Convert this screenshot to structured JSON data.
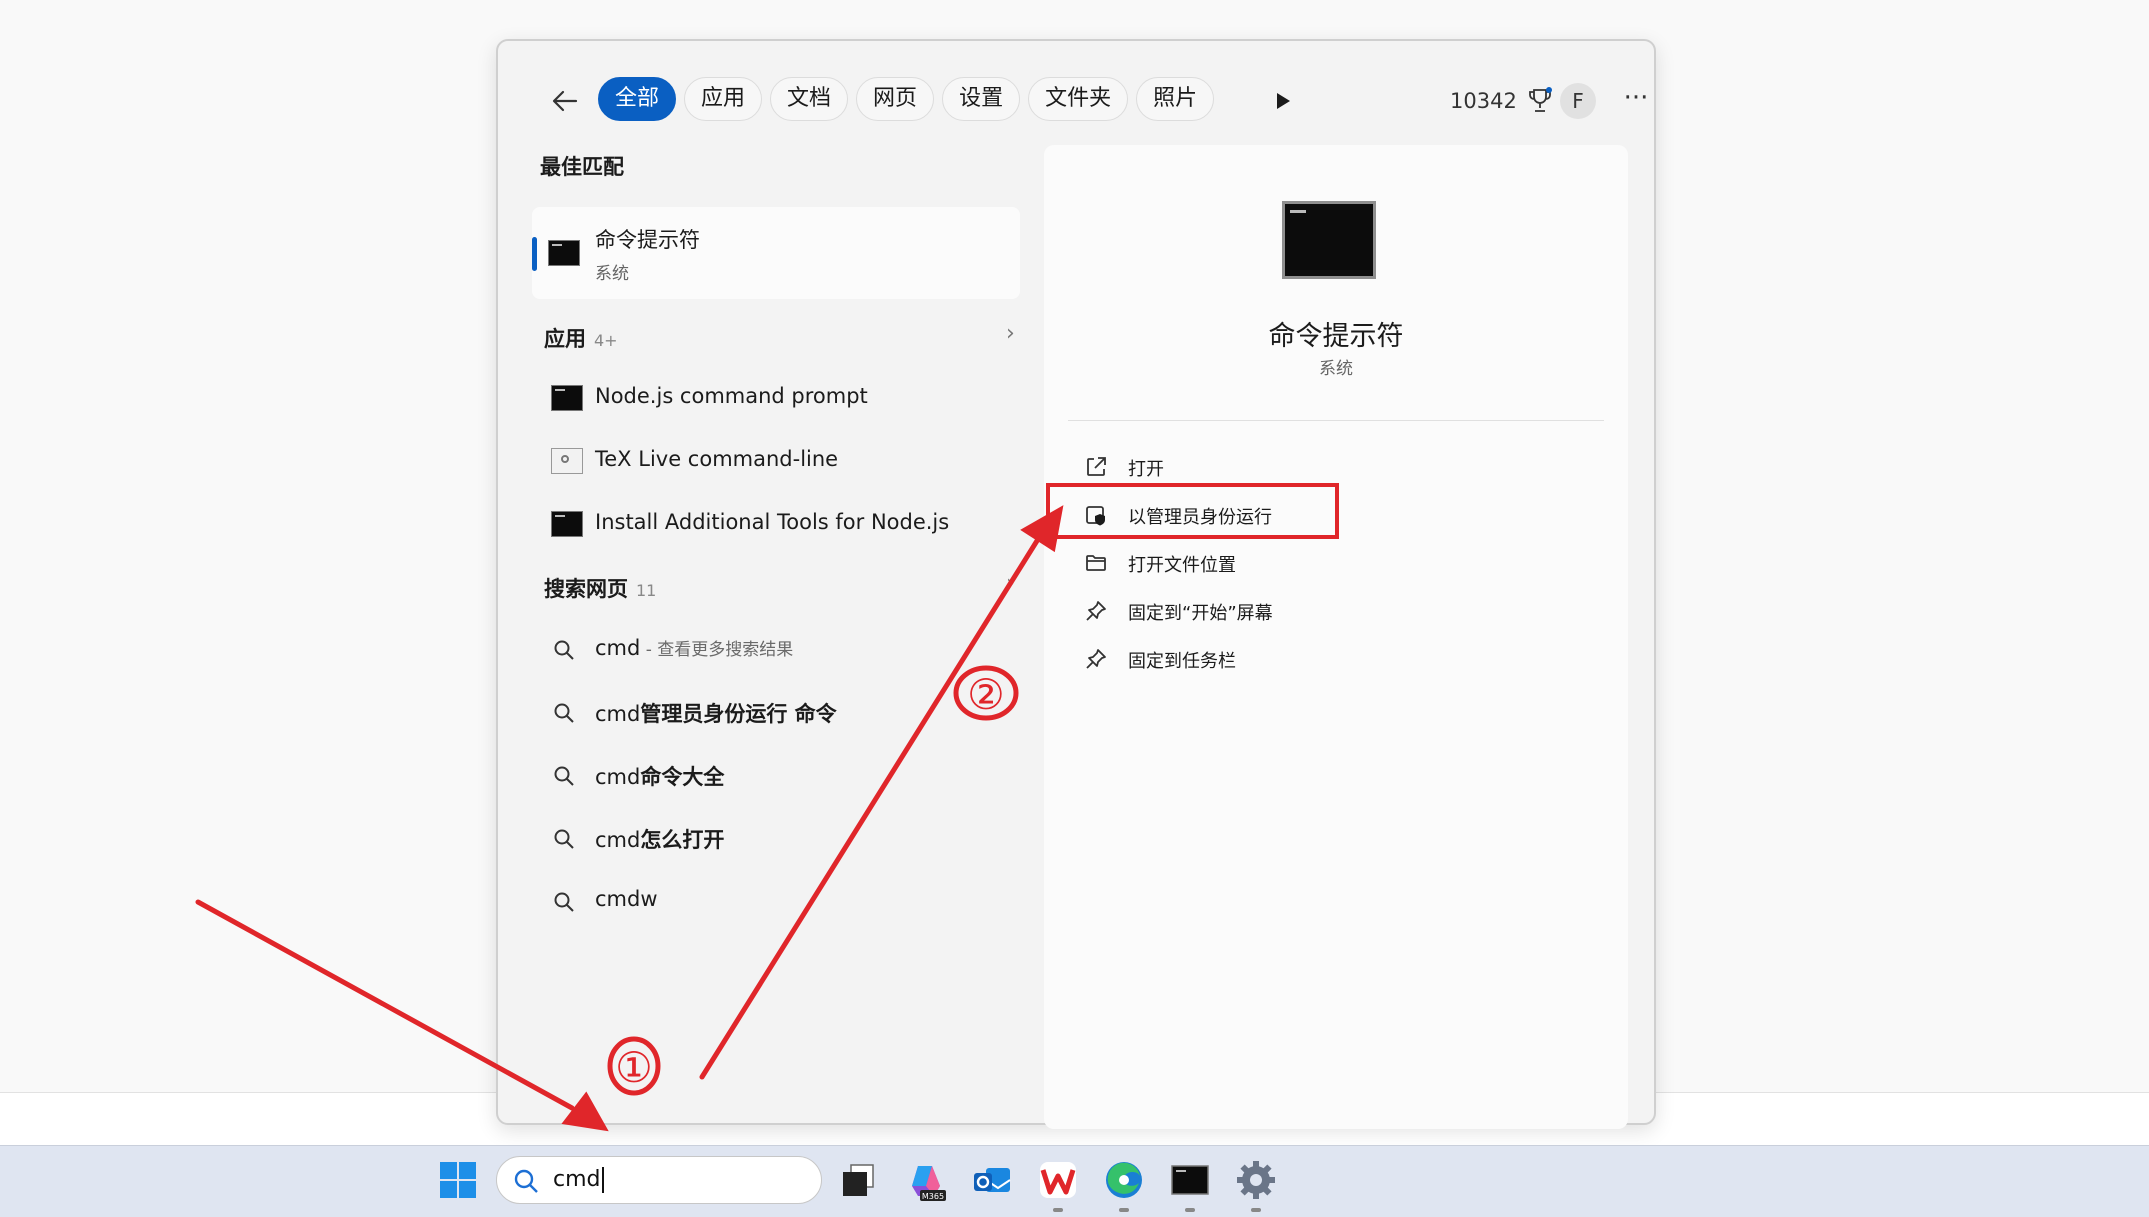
{
  "toolbar": {
    "back_icon": "arrow-left-icon",
    "tabs": [
      "全部",
      "应用",
      "文档",
      "网页",
      "设置",
      "文件夹",
      "照片"
    ],
    "active_tab": "全部",
    "play_icon": "play-icon",
    "points": "10342",
    "points_icon": "rewards-trophy-icon",
    "avatar_letter": "F",
    "more_label": "···"
  },
  "best_match": {
    "heading": "最佳匹配",
    "title": "命令提示符",
    "subtitle": "系统",
    "icon": "cmd-icon"
  },
  "apps": {
    "heading": "应用",
    "count": "4+",
    "items": [
      {
        "label": "Node.js command prompt",
        "icon": "cmd-icon"
      },
      {
        "label": "TeX Live command-line",
        "icon": "tex-icon"
      },
      {
        "label": "Install Additional Tools for Node.js",
        "icon": "cmd-icon"
      }
    ]
  },
  "web": {
    "heading": "搜索网页",
    "count": "11",
    "items": [
      {
        "prefix": "cmd",
        "bold": "",
        "dim": " - 查看更多搜索结果"
      },
      {
        "prefix": "cmd",
        "bold": "管理员身份运行 命令",
        "dim": ""
      },
      {
        "prefix": "cmd",
        "bold": "命令大全",
        "dim": ""
      },
      {
        "prefix": "cmd",
        "bold": "怎么打开",
        "dim": ""
      },
      {
        "prefix": "cmdw",
        "bold": "",
        "dim": ""
      }
    ]
  },
  "detail": {
    "title": "命令提示符",
    "subtitle": "系统",
    "actions": [
      {
        "label": "打开",
        "icon": "open-external-icon"
      },
      {
        "label": "以管理员身份运行",
        "icon": "admin-shield-icon"
      },
      {
        "label": "打开文件位置",
        "icon": "folder-icon"
      },
      {
        "label": "固定到“开始”屏幕",
        "icon": "pin-icon"
      },
      {
        "label": "固定到任务栏",
        "icon": "pin-icon"
      }
    ]
  },
  "annotations": {
    "step1": "①",
    "step2": "②",
    "color": "#e0262a"
  },
  "taskbar": {
    "search_query": "cmd",
    "apps": [
      "start-windows-icon",
      "task-view-icon",
      "m365-copilot-icon",
      "outlook-icon",
      "wps-icon",
      "edge-icon",
      "terminal-icon",
      "settings-gear-icon"
    ],
    "m365_label": "M365"
  },
  "colors": {
    "accent": "#0a5fc2",
    "highlight": "#e0262a"
  }
}
